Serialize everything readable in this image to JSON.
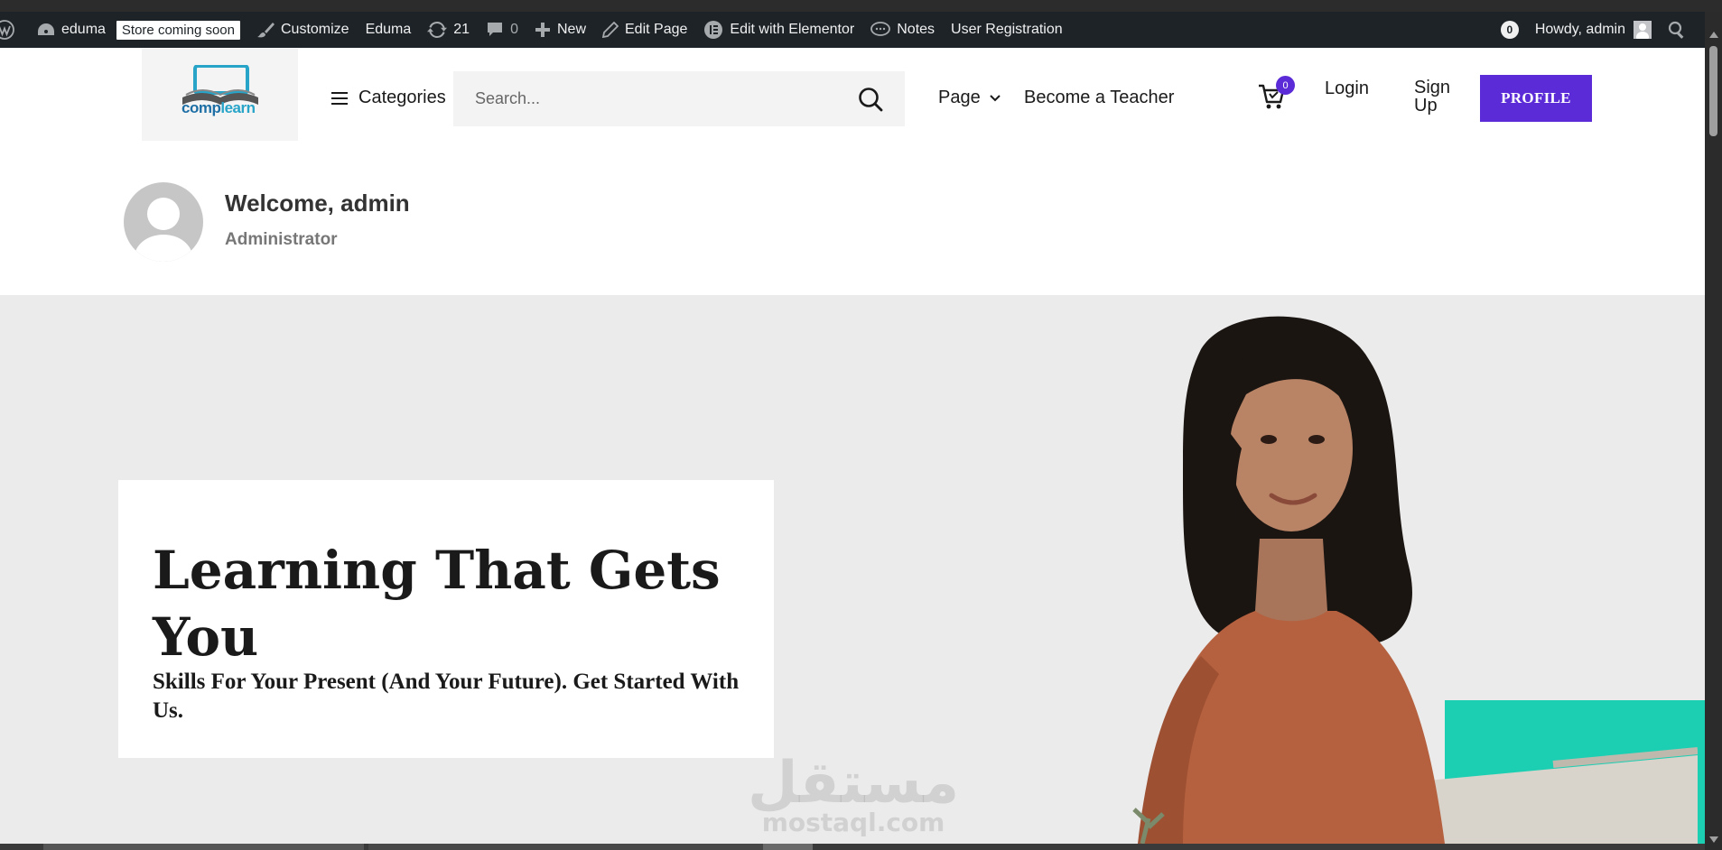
{
  "admin_bar": {
    "site_name": "eduma",
    "store_badge": "Store coming soon",
    "customize": "Customize",
    "theme": "Eduma",
    "updates_count": "21",
    "comments_count": "0",
    "new": "New",
    "edit_page": "Edit Page",
    "edit_elementor": "Edit with Elementor",
    "notes": "Notes",
    "user_registration": "User Registration",
    "notification_count": "0",
    "howdy": "Howdy, admin"
  },
  "header": {
    "logo": {
      "brand_comp": "comp",
      "brand_learn": "learn"
    },
    "categories_label": "Categories",
    "search_placeholder": "Search...",
    "nav": {
      "page": "Page",
      "become_teacher": "Become a Teacher"
    },
    "cart_count": "0",
    "login": "Login",
    "signup": "Sign Up",
    "profile_button": "PROFILE"
  },
  "welcome": {
    "title": "Welcome, admin",
    "role": "Administrator"
  },
  "hero": {
    "title": "Learning That Gets You",
    "subtitle": "Skills For Your Present (And Your Future). Get Started With Us."
  },
  "watermark": {
    "arabic": "مستقل",
    "latin": "mostaql.com"
  },
  "colors": {
    "accent": "#5a2bd6",
    "admin_bar": "#1d2327",
    "hero_bg": "#ebebeb",
    "teal": "#1dcfb2",
    "sweater": "#b5603e"
  }
}
